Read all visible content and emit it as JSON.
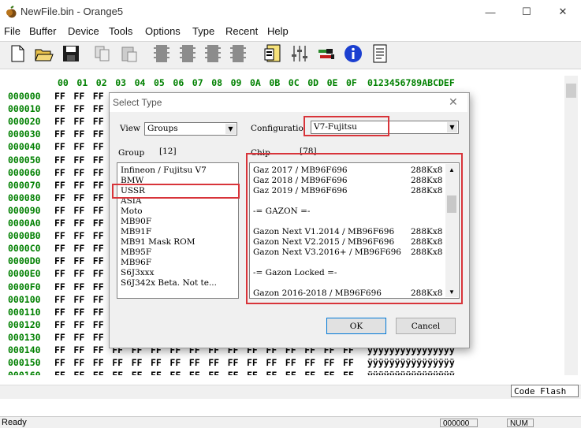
{
  "window": {
    "title": "NewFile.bin - Orange5",
    "min_glyph": "—",
    "max_glyph": "☐",
    "close_glyph": "✕"
  },
  "menu": [
    "File",
    "Buffer",
    "Device",
    "Tools",
    "Options",
    "Type",
    "Recent",
    "Help"
  ],
  "toolbar_icons": [
    "new-file-icon",
    "open-folder-icon",
    "save-icon",
    "copy-icon",
    "paste-icon",
    "chip-icon",
    "chip-icon",
    "chip-icon",
    "chip-icon",
    "chip-icon",
    "device-select-icon",
    "sliders-icon",
    "connector-icon",
    "info-icon",
    "document-icon"
  ],
  "hex": {
    "header_cols": [
      "00",
      "01",
      "02",
      "03",
      "04",
      "05",
      "06",
      "07",
      "08",
      "09",
      "0A",
      "0B",
      "0C",
      "0D",
      "0E",
      "0F"
    ],
    "ascii_header": "0123456789ABCDEF",
    "addresses": [
      "000000",
      "000010",
      "000020",
      "000030",
      "000040",
      "000050",
      "000060",
      "000070",
      "000080",
      "000090",
      "0000A0",
      "0000B0",
      "0000C0",
      "0000D0",
      "0000E0",
      "0000F0",
      "000100",
      "000110",
      "000120",
      "000130",
      "000140",
      "000150",
      "000160"
    ],
    "byte": "FF",
    "ascii_char": "ÿ"
  },
  "bottom": {
    "code_flash": "Code Flash",
    "status_text": "Ready",
    "status_offset": "000000",
    "status_num": "NUM"
  },
  "dialog": {
    "title": "Select Type",
    "close_glyph": "✕",
    "view_label": "View",
    "view_value": "Groups",
    "config_label": "Configuratio",
    "config_value": "V7-Fujitsu",
    "group_label": "Group",
    "group_count": "[12]",
    "chip_label": "Chip",
    "chip_count": "[78]",
    "groups": [
      "Infineon / Fujitsu V7",
      "BMW",
      "USSR",
      "ASIA",
      "Moto",
      "MB90F",
      "MB91F",
      "MB91 Mask ROM",
      "MB95F",
      "MB96F",
      "S6J3xxx",
      "S6J342x  Beta. Not te..."
    ],
    "chips": [
      {
        "name": "Gaz 2017 / MB96F696",
        "size": "288Kx8"
      },
      {
        "name": "Gaz 2018 / MB96F696",
        "size": "288Kx8"
      },
      {
        "name": "Gaz 2019 / MB96F696",
        "size": "288Kx8"
      },
      {
        "name": "",
        "size": ""
      },
      {
        "name": " -= GAZON =-",
        "size": ""
      },
      {
        "name": "",
        "size": ""
      },
      {
        "name": "Gazon Next V1.2014 / MB96F696",
        "size": "288Kx8"
      },
      {
        "name": "Gazon Next V2.2015 / MB96F696",
        "size": "288Kx8"
      },
      {
        "name": "Gazon Next V3.2016+ / MB96F696",
        "size": "288Kx8"
      },
      {
        "name": "",
        "size": ""
      },
      {
        "name": " -= Gazon Locked =-",
        "size": ""
      },
      {
        "name": "",
        "size": ""
      },
      {
        "name": "Gazon 2016-2018 / MB96F696",
        "size": "288Kx8"
      }
    ],
    "ok_label": "OK",
    "cancel_label": "Cancel"
  },
  "colors": {
    "address_green": "#008000",
    "highlight_red": "#d8343a"
  }
}
